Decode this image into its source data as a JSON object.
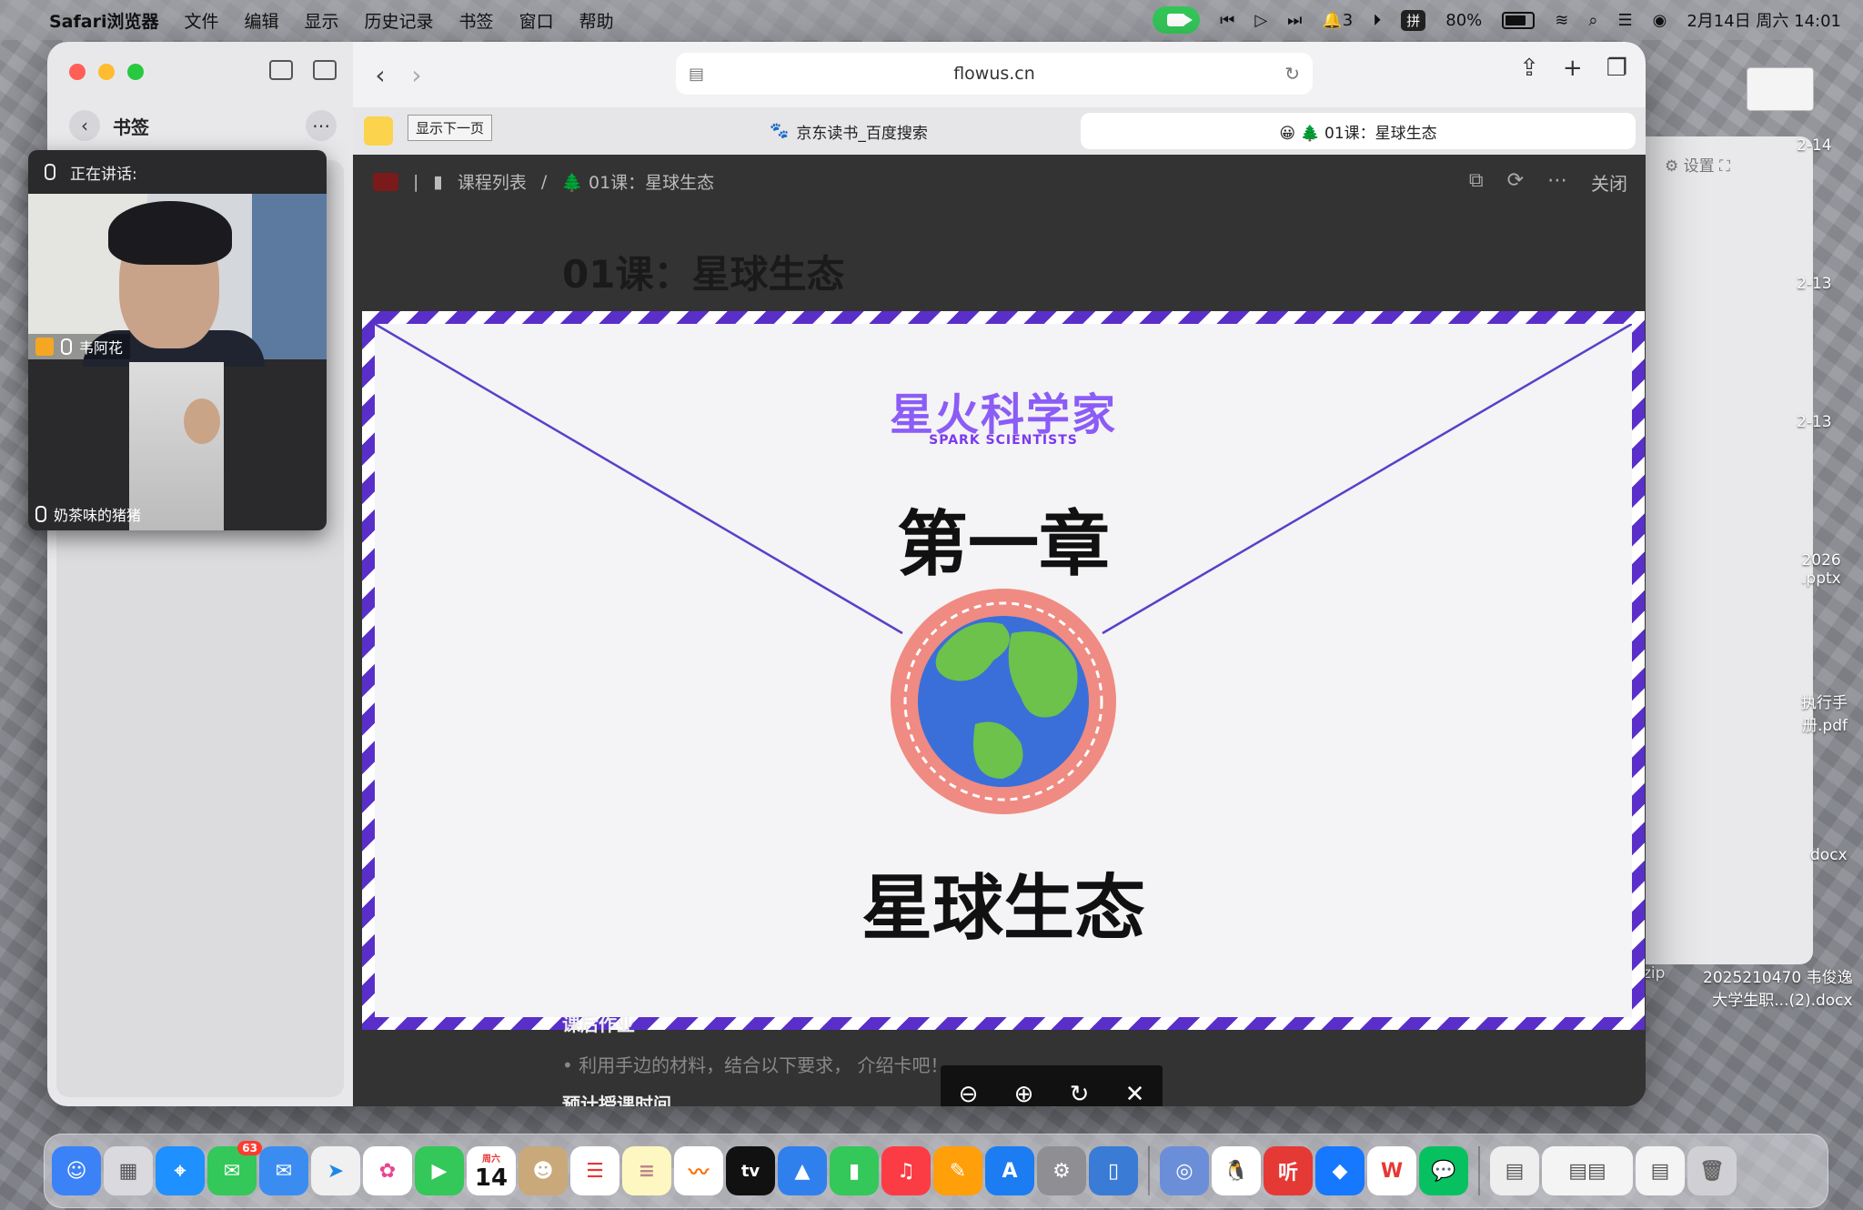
{
  "menubar": {
    "app_name": "Safari浏览器",
    "items": [
      "文件",
      "编辑",
      "显示",
      "历史记录",
      "书签",
      "窗口",
      "帮助"
    ],
    "notifications_count": "3",
    "ime_label": "拼",
    "battery_text": "80%",
    "clock": "2月14日 周六 14:01"
  },
  "sidebar": {
    "title": "书签"
  },
  "toolbar": {
    "address": "flowus.cn"
  },
  "tabs": {
    "tooltip": "显示下一页",
    "tab1_label": "京东读书_百度搜索",
    "tab2_label": "😀 🌲 01课：星球生态"
  },
  "content": {
    "breadcrumb_1": "课程列表",
    "breadcrumb_2": "🌲 01课：星球生态",
    "close_label": "关闭",
    "peek_title": "01课：星球生态",
    "homework_title": "课后作业",
    "homework_line": "•  利用手边的材料，结合以下要求，                          介绍卡吧！",
    "homework_next": "预计授课时间"
  },
  "slide": {
    "logo_cn": "星火科学家",
    "logo_en": "SPARK SCIENTISTS",
    "chapter": "第一章",
    "title": "星球生态"
  },
  "call": {
    "speaking_label": "正在讲话:",
    "participant1": "韦阿花",
    "participant2": "奶茶味的猪猪"
  },
  "desktop_files": {
    "date1": "2-14",
    "date2": "2-13",
    "date3": "2-13",
    "file1": "2026\n.pptx",
    "file2": "执行手\n册.pdf",
    "file3": "docx",
    "file4": "zip",
    "file5": "2025210470 韦俊逸\n大学生职...(2).docx",
    "ghost_settings": "设置"
  },
  "dock": {
    "messages_badge": "63",
    "calendar_day": "14",
    "calendar_weekday": "周六",
    "tv_label": "tv"
  },
  "colors": {
    "slide_purple": "#5a2fc9",
    "logo_purple": "#8b5cf6",
    "facetime_green": "#34c759"
  }
}
